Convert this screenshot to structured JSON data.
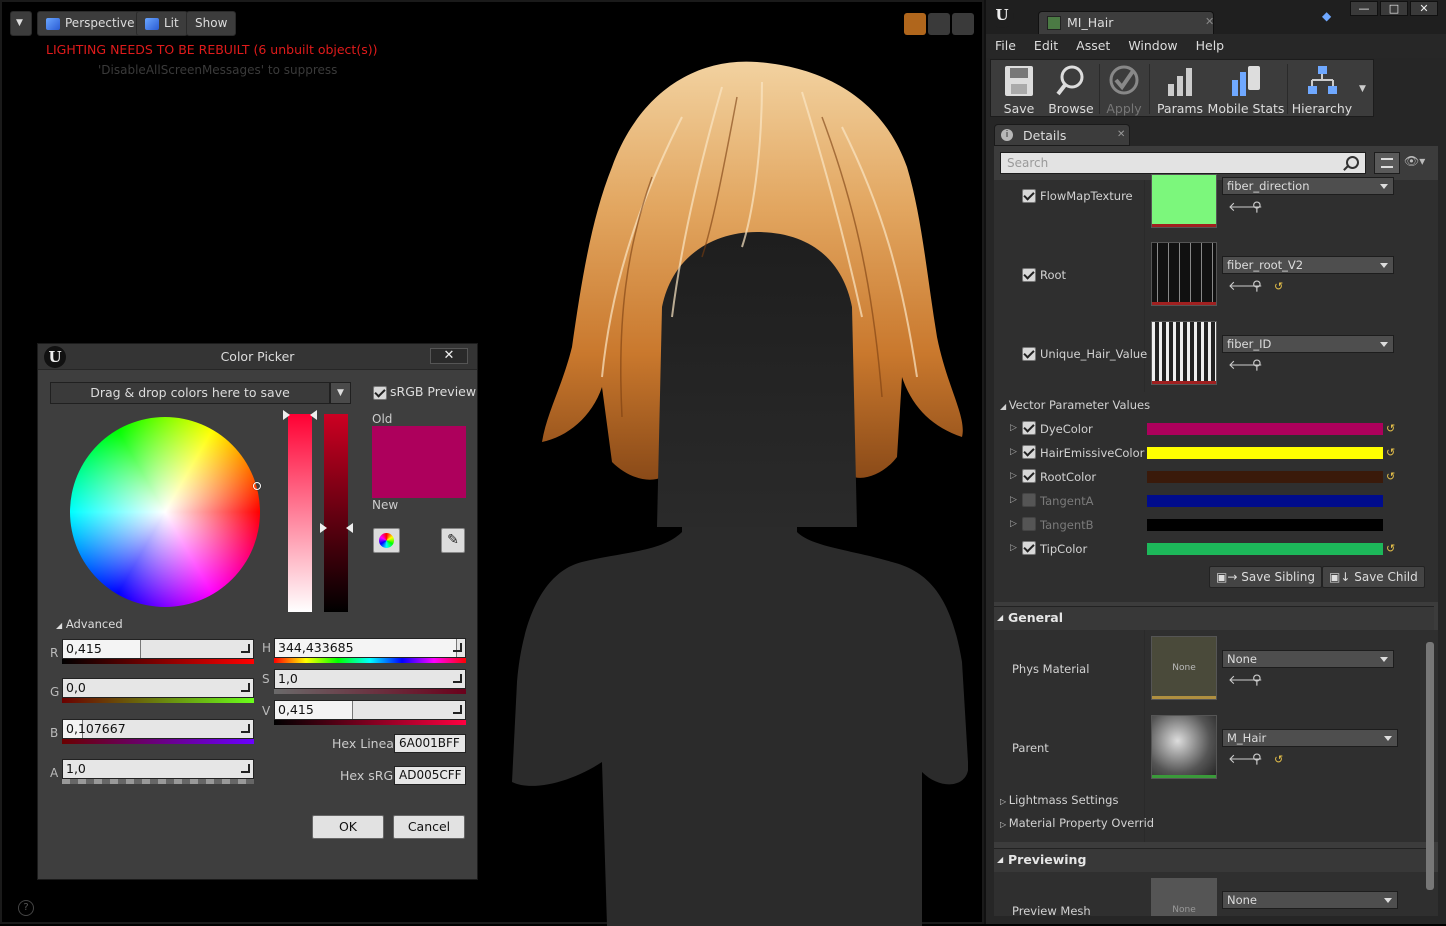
{
  "viewport": {
    "perspective_label": "Perspective",
    "lit_label": "Lit",
    "show_label": "Show",
    "lighting_warning": "LIGHTING NEEDS TO BE REBUILT (6 unbuilt object(s))",
    "suppress_hint": "'DisableAllScreenMessages' to suppress",
    "help_glyph": "?"
  },
  "color_picker": {
    "title": "Color Picker",
    "close_glyph": "✕",
    "drop_zone_label": "Drag & drop colors here to save",
    "srgb_preview_label": "sRGB Preview",
    "srgb_preview_checked": true,
    "old_label": "Old",
    "new_label": "New",
    "old_color": "#AD005C",
    "advanced_label": "Advanced",
    "fields": {
      "r": {
        "label": "R",
        "value": "0,415"
      },
      "g": {
        "label": "G",
        "value": "0,0"
      },
      "b": {
        "label": "B",
        "value": "0,107667"
      },
      "a": {
        "label": "A",
        "value": "1,0"
      },
      "h": {
        "label": "H",
        "value": "344,433685"
      },
      "s": {
        "label": "S",
        "value": "1,0"
      },
      "v": {
        "label": "V",
        "value": "0,415"
      }
    },
    "hex_linear_label": "Hex Linear",
    "hex_linear_value": "6A001BFF",
    "hex_srgb_label": "Hex sRGB",
    "hex_srgb_value": "AD005CFF",
    "ok_label": "OK",
    "cancel_label": "Cancel"
  },
  "material_editor": {
    "tab_title": "MI_Hair",
    "menu": [
      "File",
      "Edit",
      "Asset",
      "Window",
      "Help"
    ],
    "toolbar": {
      "save": "Save",
      "browse": "Browse",
      "apply": "Apply",
      "params": "Params",
      "mobile_stats": "Mobile Stats",
      "hierarchy": "Hierarchy"
    },
    "details_tab": "Details",
    "search_placeholder": "Search",
    "textures": [
      {
        "name": "FlowMapTexture",
        "asset": "fiber_direction",
        "checked": true
      },
      {
        "name": "Root",
        "asset": "fiber_root_V2",
        "checked": true
      },
      {
        "name": "Unique_Hair_Value",
        "asset": "fiber_ID",
        "checked": true
      }
    ],
    "vector_section_label": "Vector Parameter Values",
    "vectors": [
      {
        "name": "DyeColor",
        "color": "#AD005C",
        "checked": true
      },
      {
        "name": "HairEmissiveColor",
        "color": "#FFFF00",
        "checked": true
      },
      {
        "name": "RootColor",
        "color": "#3A1A0A",
        "checked": true
      },
      {
        "name": "TangentA",
        "color": "#000C8C",
        "checked": false
      },
      {
        "name": "TangentB",
        "color": "#000000",
        "checked": false
      },
      {
        "name": "TipColor",
        "color": "#1DB85A",
        "checked": true
      }
    ],
    "save_sibling_label": "Save Sibling",
    "save_child_label": "Save Child",
    "general_label": "General",
    "phys_material_label": "Phys Material",
    "phys_material_value": "None",
    "phys_thumb_text": "None",
    "parent_label": "Parent",
    "parent_value": "M_Hair",
    "lightmass_label": "Lightmass Settings",
    "material_property_label": "Material Property Overrid",
    "previewing_label": "Previewing",
    "preview_mesh_label": "Preview Mesh",
    "preview_mesh_value": "None",
    "preview_thumb_text": "None"
  }
}
